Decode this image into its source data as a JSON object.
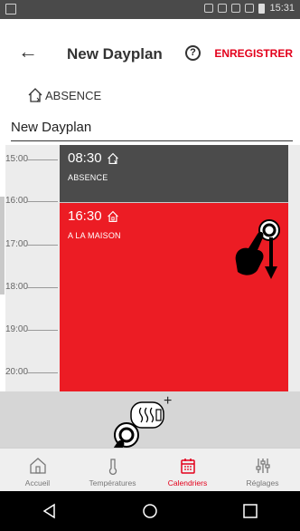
{
  "status_bar": {
    "time": "15:31"
  },
  "header": {
    "back_label": "←",
    "title": "New Dayplan",
    "help_label": "?",
    "save_label": "ENREGISTRER"
  },
  "mode": {
    "label": "ABSENCE",
    "icon": "house-away-icon"
  },
  "dayplan_name": {
    "value": "New Dayplan"
  },
  "timeline": {
    "hours": [
      "15:00",
      "16:00",
      "17:00",
      "18:00",
      "19:00",
      "20:00"
    ],
    "segments": [
      {
        "time": "08:30",
        "label": "ABSENCE",
        "icon": "house-away-icon",
        "color": "#4b4b4b"
      },
      {
        "time": "16:30",
        "label": "A LA MAISON",
        "icon": "house-home-icon",
        "color": "#ec1c24"
      }
    ]
  },
  "add_segment": {
    "plus": "+",
    "icon": "heater-icon"
  },
  "bottom_nav": {
    "items": [
      {
        "label": "Accueil",
        "icon": "home-icon"
      },
      {
        "label": "Températures",
        "icon": "thermometer-icon"
      },
      {
        "label": "Calendriers",
        "icon": "calendar-icon",
        "active": true
      },
      {
        "label": "Réglages",
        "icon": "sliders-icon"
      }
    ]
  },
  "colors": {
    "accent": "#e3001b",
    "home_segment": "#ec1c24",
    "absence_segment": "#4b4b4b"
  }
}
